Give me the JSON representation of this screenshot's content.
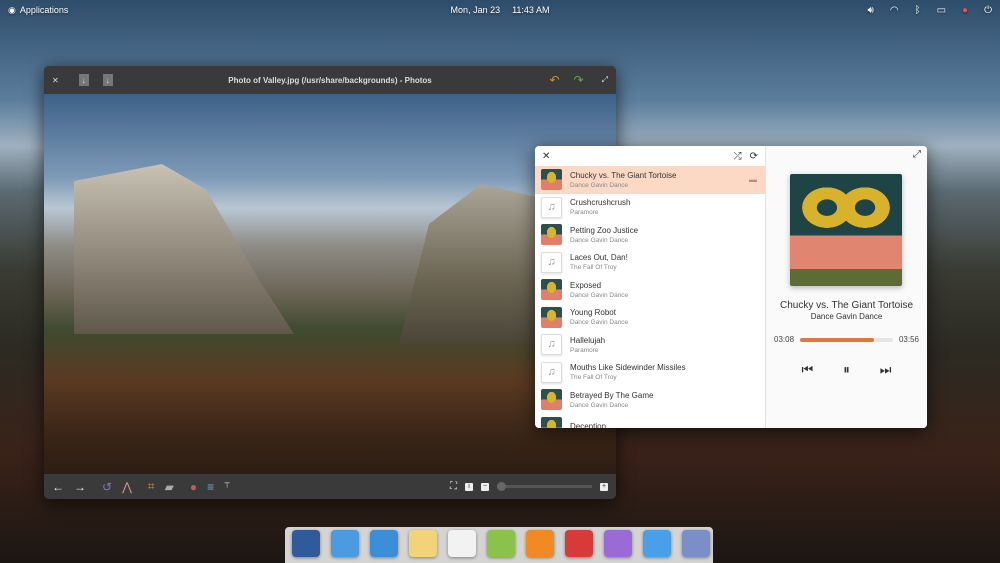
{
  "topbar": {
    "applications": "Applications",
    "date": "Mon, Jan 23",
    "time": "11:43 AM",
    "indicators": [
      "volume-icon",
      "wifi-icon",
      "bluetooth-disabled-icon",
      "battery-charging-icon",
      "notifications-icon",
      "power-icon"
    ]
  },
  "photos": {
    "title": "Photo of Valley.jpg (/usr/share/backgrounds) - Photos"
  },
  "music": {
    "tracks": [
      {
        "title": "Chucky vs. The Giant Tortoise",
        "artist": "Dance Gavin Dance",
        "art": "cover",
        "selected": true
      },
      {
        "title": "Crushcrushcrush",
        "artist": "Paramore",
        "art": "note"
      },
      {
        "title": "Petting Zoo Justice",
        "artist": "Dance Gavin Dance",
        "art": "cover"
      },
      {
        "title": "Laces Out, Dan!",
        "artist": "The Fall Of Troy",
        "art": "note"
      },
      {
        "title": "Exposed",
        "artist": "Dance Gavin Dance",
        "art": "cover"
      },
      {
        "title": "Young Robot",
        "artist": "Dance Gavin Dance",
        "art": "cover"
      },
      {
        "title": "Hallelujah",
        "artist": "Paramore",
        "art": "note"
      },
      {
        "title": "Mouths Like Sidewinder Missiles",
        "artist": "The Fall Of Troy",
        "art": "note"
      },
      {
        "title": "Betrayed By The Game",
        "artist": "Dance Gavin Dance",
        "art": "cover"
      },
      {
        "title": "Deception",
        "artist": "",
        "art": "cover"
      }
    ],
    "now_playing": {
      "title": "Chucky vs. The Giant Tortoise",
      "artist": "Dance Gavin Dance",
      "elapsed": "03:08",
      "duration": "03:56",
      "progress": 0.8
    },
    "accent": "#e07a3a"
  },
  "dock": [
    {
      "name": "multitasking",
      "color": "#2f5b9a"
    },
    {
      "name": "files",
      "color": "#4a9be0"
    },
    {
      "name": "browser",
      "color": "#3c8fd6"
    },
    {
      "name": "mail",
      "color": "#f3d37a"
    },
    {
      "name": "tasks",
      "color": "#f2f2f2"
    },
    {
      "name": "calendar",
      "color": "#8bc34a"
    },
    {
      "name": "music",
      "color": "#f08a24"
    },
    {
      "name": "videos",
      "color": "#d83a3a"
    },
    {
      "name": "photos",
      "color": "#9a6bd6"
    },
    {
      "name": "settings",
      "color": "#4aa0e8"
    },
    {
      "name": "appcenter",
      "color": "#7a8fc8"
    }
  ]
}
